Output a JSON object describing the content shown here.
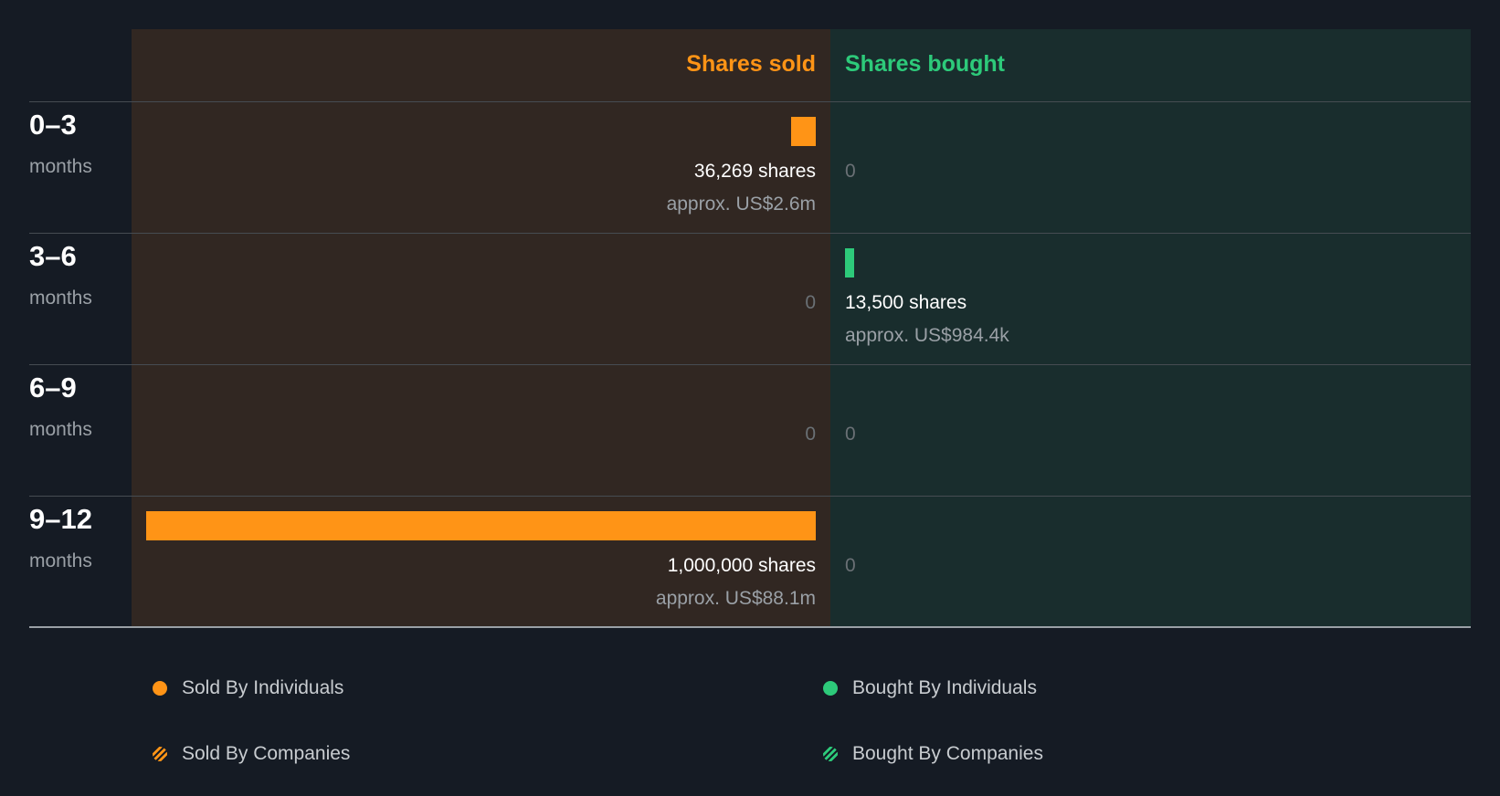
{
  "chart_data": {
    "type": "bar",
    "title": "",
    "headers": {
      "sold": "Shares sold",
      "bought": "Shares bought"
    },
    "colors": {
      "sold": "#ff9416",
      "bought": "#2dca7a"
    },
    "periods": [
      {
        "label": "0–3",
        "unit": "months",
        "sold": {
          "shares": 36269,
          "text": "36,269 shares",
          "approx": "approx. US$2.6m"
        },
        "bought": {
          "shares": 0,
          "text": "0",
          "approx": ""
        }
      },
      {
        "label": "3–6",
        "unit": "months",
        "sold": {
          "shares": 0,
          "text": "0",
          "approx": ""
        },
        "bought": {
          "shares": 13500,
          "text": "13,500 shares",
          "approx": "approx. US$984.4k"
        }
      },
      {
        "label": "6–9",
        "unit": "months",
        "sold": {
          "shares": 0,
          "text": "0",
          "approx": ""
        },
        "bought": {
          "shares": 0,
          "text": "0",
          "approx": ""
        }
      },
      {
        "label": "9–12",
        "unit": "months",
        "sold": {
          "shares": 1000000,
          "text": "1,000,000 shares",
          "approx": "approx. US$88.1m"
        },
        "bought": {
          "shares": 0,
          "text": "0",
          "approx": ""
        }
      }
    ],
    "legend": [
      {
        "label": "Sold By Individuals",
        "color": "#ff9416",
        "pattern": "solid"
      },
      {
        "label": "Bought By Individuals",
        "color": "#2dca7a",
        "pattern": "solid"
      },
      {
        "label": "Sold By Companies",
        "color": "#ff9416",
        "pattern": "striped"
      },
      {
        "label": "Bought By Companies",
        "color": "#2dca7a",
        "pattern": "striped"
      }
    ]
  }
}
